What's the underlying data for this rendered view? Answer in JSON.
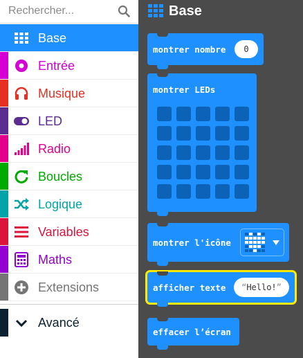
{
  "search": {
    "placeholder": "Rechercher..."
  },
  "categories": [
    {
      "label": "Base",
      "icon": "grid-icon",
      "color": "#1e90ff",
      "active": true
    },
    {
      "label": "Entrée",
      "icon": "circle-dot-icon",
      "color": "#d400d4"
    },
    {
      "label": "Musique",
      "icon": "headphones-icon",
      "color": "#e63022"
    },
    {
      "label": "LED",
      "icon": "toggle-icon",
      "color": "#5c2d91"
    },
    {
      "label": "Radio",
      "icon": "signal-bars-icon",
      "color": "#e3008c"
    },
    {
      "label": "Boucles",
      "icon": "refresh-icon",
      "color": "#00aa00"
    },
    {
      "label": "Logique",
      "icon": "shuffle-icon",
      "color": "#00a4a6"
    },
    {
      "label": "Variables",
      "icon": "list-icon",
      "color": "#dc143c"
    },
    {
      "label": "Maths",
      "icon": "calculator-icon",
      "color": "#9400d3"
    },
    {
      "label": "Extensions",
      "icon": "plus-circle-icon",
      "color": "#757575"
    },
    {
      "label": "Avancé",
      "icon": "chevron-down-icon",
      "color": "#0b2130"
    }
  ],
  "workspace": {
    "title": "Base",
    "blocks": {
      "show_number": {
        "label": "montrer nombre",
        "value": "0"
      },
      "show_leds": {
        "label": "montrer LEDs"
      },
      "show_icon": {
        "label": "montrer l'icône"
      },
      "show_string": {
        "label": "afficher texte",
        "value": "Hello!"
      },
      "clear_screen": {
        "label": "effacer l’écran"
      }
    }
  }
}
